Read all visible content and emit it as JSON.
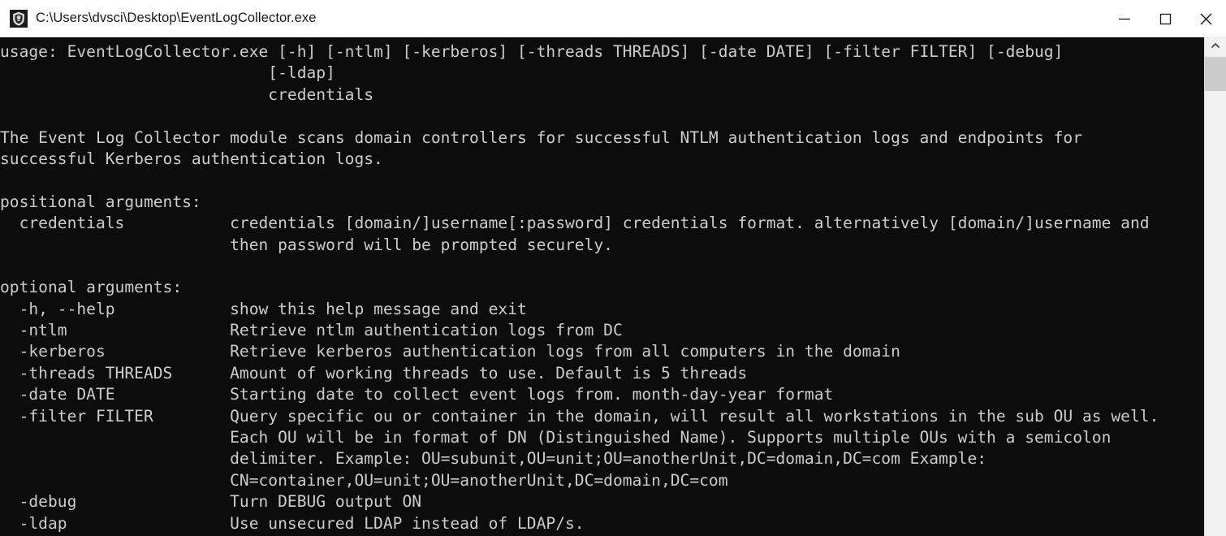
{
  "window": {
    "title": "C:\\Users\\dvsci\\Desktop\\EventLogCollector.exe",
    "icon": "shield-app-icon",
    "controls": {
      "minimize_label": "Minimize",
      "maximize_label": "Maximize",
      "close_label": "Close"
    },
    "titlebar_bg": "#ffffff",
    "titlebar_fg": "#1a1a1a"
  },
  "console": {
    "background": "#0c0c0c",
    "foreground": "#cccccc",
    "lines": [
      "usage: EventLogCollector.exe [-h] [-ntlm] [-kerberos] [-threads THREADS] [-date DATE] [-filter FILTER] [-debug]",
      "                            [-ldap]",
      "                            credentials",
      "",
      "The Event Log Collector module scans domain controllers for successful NTLM authentication logs and endpoints for",
      "successful Kerberos authentication logs.",
      "",
      "positional arguments:",
      "  credentials           credentials [domain/]username[:password] credentials format. alternatively [domain/]username and",
      "                        then password will be prompted securely.",
      "",
      "optional arguments:",
      "  -h, --help            show this help message and exit",
      "  -ntlm                 Retrieve ntlm authentication logs from DC",
      "  -kerberos             Retrieve kerberos authentication logs from all computers in the domain",
      "  -threads THREADS      Amount of working threads to use. Default is 5 threads",
      "  -date DATE            Starting date to collect event logs from. month-day-year format",
      "  -filter FILTER        Query specific ou or container in the domain, will result all workstations in the sub OU as well.",
      "                        Each OU will be in format of DN (Distinguished Name). Supports multiple OUs with a semicolon",
      "                        delimiter. Example: OU=subunit,OU=unit;OU=anotherUnit,DC=domain,DC=com Example:",
      "                        CN=container,OU=unit;OU=anotherUnit,DC=domain,DC=com",
      "  -debug                Turn DEBUG output ON",
      "  -ldap                 Use unsecured LDAP instead of LDAP/s."
    ]
  },
  "scrollbar": {
    "up_arrow": "chevron-up-icon",
    "thumb_label": "scroll-thumb",
    "track_bg": "#f0f0f0",
    "thumb_bg": "#cdcdcd"
  }
}
